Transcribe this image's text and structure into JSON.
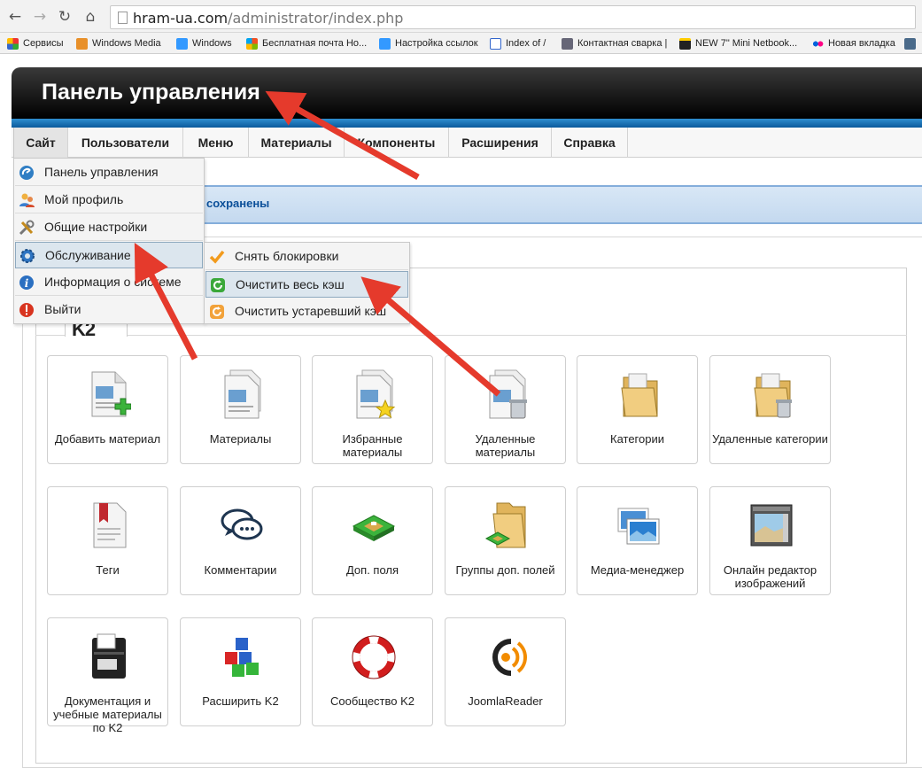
{
  "browser": {
    "url_host": "hram-ua.com",
    "url_path": "/administrator/index.php",
    "bookmarks": [
      "Сервисы",
      "Windows Media",
      "Windows",
      "Бесплатная почта Но...",
      "Настройка ссылок",
      "Index of /",
      "Контактная сварка |",
      "NEW 7\" Mini Netbook...",
      "Новая вкладка"
    ]
  },
  "header": {
    "title": "Панель управления"
  },
  "menu": [
    "Сайт",
    "Пользователи",
    "Меню",
    "Материалы",
    "Компоненты",
    "Расширения",
    "Справка"
  ],
  "message": "сохранены",
  "k2_tab": "K2",
  "site_dropdown": [
    {
      "label": "Панель управления",
      "icon": "dashboard-icon"
    },
    {
      "label": "Мой профиль",
      "icon": "profile-icon"
    },
    {
      "label": "Общие настройки",
      "icon": "tools-icon"
    },
    {
      "label": "Обслуживание",
      "icon": "gear-icon"
    },
    {
      "label": "Информация о системе",
      "icon": "info-icon"
    },
    {
      "label": "Выйти",
      "icon": "logout-icon"
    }
  ],
  "maintenance_submenu": [
    {
      "label": "Снять блокировки",
      "icon": "checkmark-icon"
    },
    {
      "label": "Очистить весь кэш",
      "icon": "refresh-green-icon"
    },
    {
      "label": "Очистить устаревший кэш",
      "icon": "refresh-orange-icon"
    }
  ],
  "tiles": [
    {
      "label": "Добавить материал",
      "icon": "add-item-icon"
    },
    {
      "label": "Материалы",
      "icon": "items-icon"
    },
    {
      "label": "Избранные материалы",
      "icon": "featured-items-icon"
    },
    {
      "label": "Удаленные материалы",
      "icon": "trashed-items-icon"
    },
    {
      "label": "Категории",
      "icon": "categories-icon"
    },
    {
      "label": "Удаленные категории",
      "icon": "trashed-categories-icon"
    },
    {
      "label": "Теги",
      "icon": "tags-icon"
    },
    {
      "label": "Комментарии",
      "icon": "comments-icon"
    },
    {
      "label": "Доп. поля",
      "icon": "extra-fields-icon"
    },
    {
      "label": "Группы доп. полей",
      "icon": "extra-field-groups-icon"
    },
    {
      "label": "Медиа-менеджер",
      "icon": "media-manager-icon"
    },
    {
      "label": "Онлайн редактор изображений",
      "icon": "image-editor-icon"
    },
    {
      "label": "Документация и учебные материалы по K2",
      "icon": "documentation-icon"
    },
    {
      "label": "Расширить K2",
      "icon": "extend-icon"
    },
    {
      "label": "Сообщество K2",
      "icon": "community-icon"
    },
    {
      "label": "JoomlaReader",
      "icon": "joomlareader-icon"
    }
  ]
}
